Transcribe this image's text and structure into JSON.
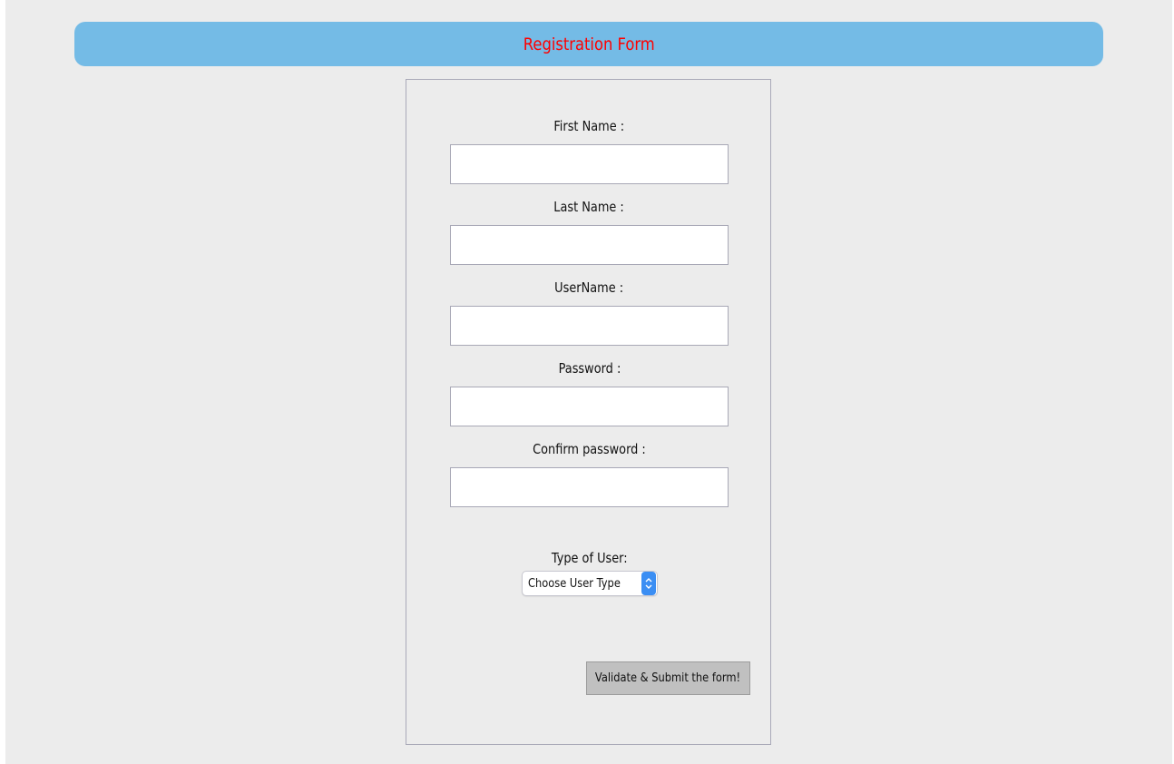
{
  "header": {
    "title": "Registration Form",
    "colors": {
      "bar_background": "#74bbe6",
      "title_text": "#ff0000"
    }
  },
  "form": {
    "fields": [
      {
        "label": "First Name :",
        "value": "",
        "input_type": "text"
      },
      {
        "label": "Last Name :",
        "value": "",
        "input_type": "text"
      },
      {
        "label": "UserName :",
        "value": "",
        "input_type": "text"
      },
      {
        "label": "Password :",
        "value": "",
        "input_type": "password"
      },
      {
        "label": "Confirm password :",
        "value": "",
        "input_type": "password"
      }
    ],
    "user_type": {
      "label": "Type of User:",
      "selected": "Choose User Type",
      "icon": "up-down-chevron-icon"
    },
    "submit_label": "Validate & Submit the form!"
  },
  "colors": {
    "page_background": "#ececec",
    "select_arrow_background": "#3b8ef3",
    "button_background": "#c0c0c0"
  }
}
